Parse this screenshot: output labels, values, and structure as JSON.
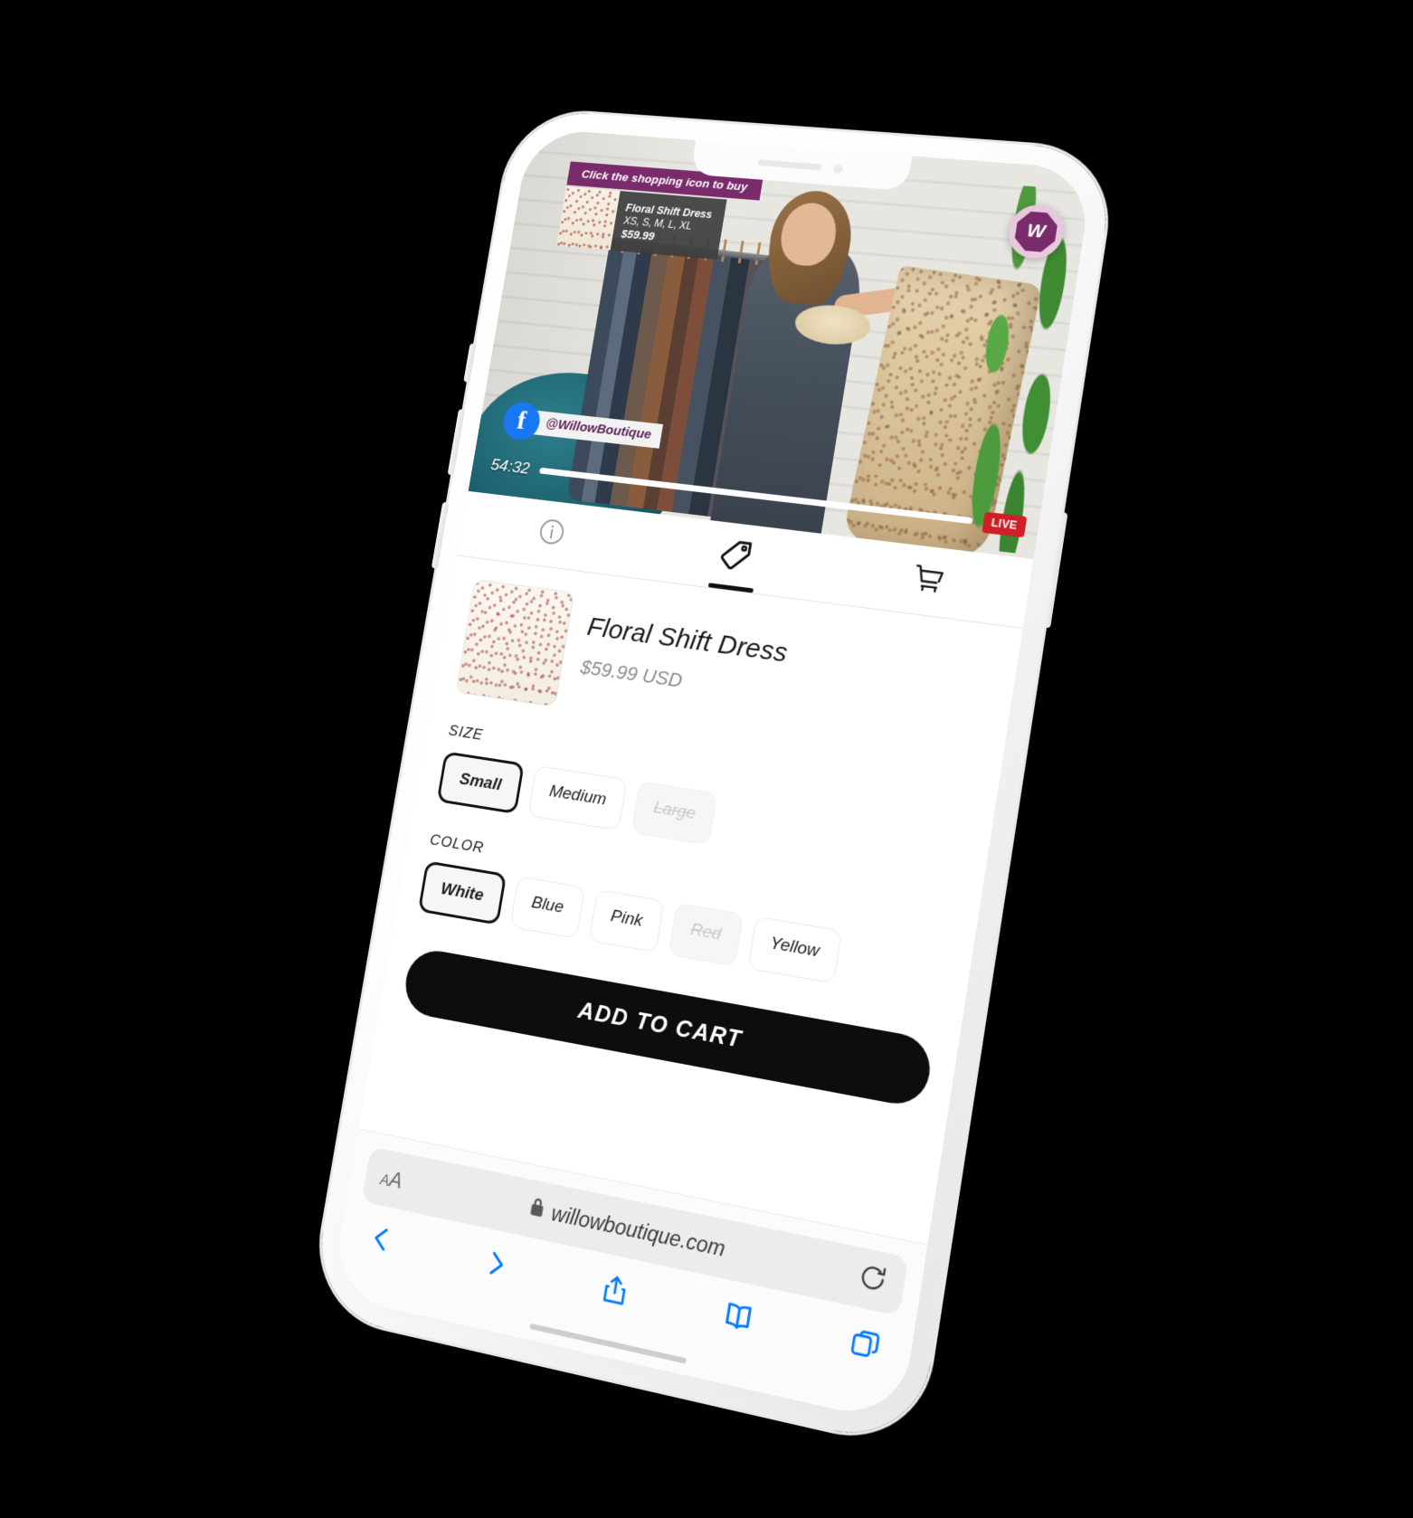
{
  "video": {
    "promo_banner": "Click the shopping icon to buy",
    "promo_card": {
      "name": "Floral Shift Dress",
      "sizes": "XS, S, M, L, XL",
      "price": "$59.99"
    },
    "brand_badge_letter": "W",
    "facebook_logo_glyph": "f",
    "facebook_handle": "@WillowBoutique",
    "timer": "54:32",
    "live_label": "LIVE",
    "colors": {
      "promo_banner_bg": "#7a2b6b",
      "promo_card_bg": "#3e3e3e",
      "facebook_blue": "#1877F2",
      "live_red": "#cf2027",
      "brand_ring": "#e7c9de"
    }
  },
  "tabs": [
    {
      "name": "info",
      "icon": "info-circle-icon",
      "active": false
    },
    {
      "name": "shop",
      "icon": "price-tag-icon",
      "active": true
    },
    {
      "name": "cart",
      "icon": "shopping-cart-icon",
      "active": false
    }
  ],
  "product": {
    "title": "Floral Shift Dress",
    "price": "$59.99 USD",
    "thumbnail_alt": "floral-shift-dress-thumbnail"
  },
  "size": {
    "label": "SIZE",
    "options": [
      {
        "label": "Small",
        "selected": true,
        "disabled": false
      },
      {
        "label": "Medium",
        "selected": false,
        "disabled": false
      },
      {
        "label": "Large",
        "selected": false,
        "disabled": true
      }
    ]
  },
  "color": {
    "label": "COLOR",
    "options": [
      {
        "label": "White",
        "selected": true,
        "disabled": false
      },
      {
        "label": "Blue",
        "selected": false,
        "disabled": false
      },
      {
        "label": "Pink",
        "selected": false,
        "disabled": false
      },
      {
        "label": "Red",
        "selected": false,
        "disabled": true
      },
      {
        "label": "Yellow",
        "selected": false,
        "disabled": false
      }
    ]
  },
  "cta": {
    "label": "ADD TO CART"
  },
  "browser": {
    "text_size_label_small": "A",
    "text_size_label_large": "A",
    "lock_icon": "lock-icon",
    "url": "willowboutique.com",
    "reload_icon": "reload-icon",
    "nav": [
      {
        "name": "back",
        "icon": "chevron-left-icon"
      },
      {
        "name": "forward",
        "icon": "chevron-right-icon"
      },
      {
        "name": "share",
        "icon": "share-icon"
      },
      {
        "name": "bookmarks",
        "icon": "book-icon"
      },
      {
        "name": "tabs",
        "icon": "tabs-icon"
      }
    ],
    "accent": "#007AFF"
  }
}
